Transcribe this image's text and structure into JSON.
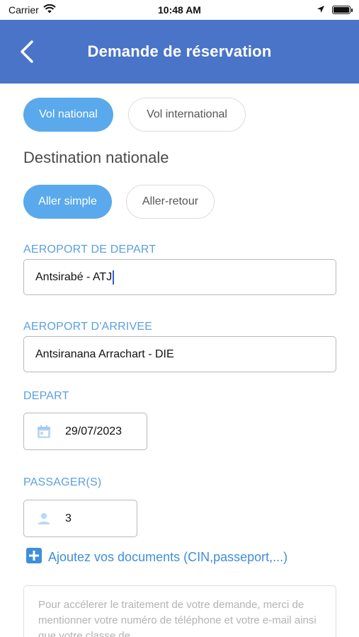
{
  "status_bar": {
    "carrier": "Carrier",
    "time": "10:48 AM",
    "battery_level": 1.0
  },
  "header": {
    "title": "Demande de réservation",
    "back_icon": "chevron-left-icon",
    "background_color": "#4a74c7"
  },
  "flight_type": {
    "options": [
      "Vol national",
      "Vol international"
    ],
    "selected": "Vol national"
  },
  "section_title": "Destination nationale",
  "trip_type": {
    "options": [
      "Aller simple",
      "Aller-retour"
    ],
    "selected": "Aller simple"
  },
  "form": {
    "departure_airport": {
      "label": "AEROPORT DE DEPART",
      "value": "Antsirabé - ATJ"
    },
    "arrival_airport": {
      "label": "AEROPORT D'ARRIVEE",
      "value": "Antsiranana Arrachart - DIE"
    },
    "departure_date": {
      "label": "DEPART",
      "value": "29/07/2023",
      "icon": "calendar-icon"
    },
    "passengers": {
      "label": "PASSAGER(S)",
      "value": "3",
      "icon": "person-icon"
    }
  },
  "add_documents": {
    "label": "Ajoutez vos documents (CIN,passeport,...)",
    "icon": "plus-square-icon"
  },
  "notes": {
    "placeholder": "Pour accélerer le traitement de votre demande, merci de mentionner votre numéro de téléphone et votre e-mail ainsi que votre classe de"
  },
  "colors": {
    "accent": "#5aa9ec",
    "label": "#5aa0e0",
    "link": "#3f8fd8"
  }
}
